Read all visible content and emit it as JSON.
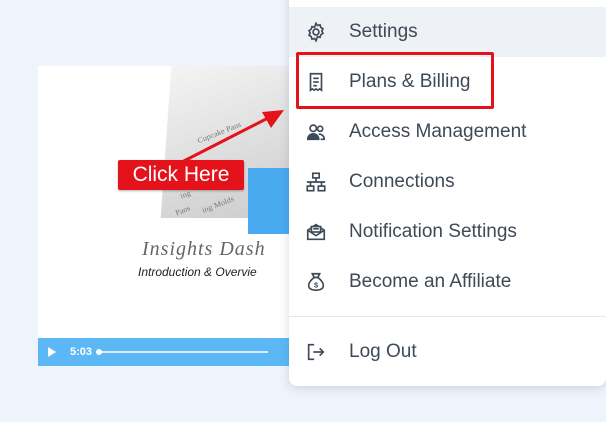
{
  "video": {
    "title": "Insights Dash",
    "subtitle": "Introduction  & Overvie",
    "duration": "5:03",
    "progress": 0.02,
    "thumb_lines": [
      "Cupcake Pans",
      "Pans",
      "ing Molds",
      "ing"
    ]
  },
  "callout": {
    "label": "Click Here",
    "color": "#e4121b"
  },
  "menu": {
    "items": [
      {
        "label": "Settings",
        "icon": "gear-icon"
      },
      {
        "label": "Plans & Billing",
        "icon": "receipt-icon"
      },
      {
        "label": "Access Management",
        "icon": "users-icon"
      },
      {
        "label": "Connections",
        "icon": "network-icon"
      },
      {
        "label": "Notification Settings",
        "icon": "envelope-icon"
      },
      {
        "label": "Become an Affiliate",
        "icon": "money-bag-icon"
      },
      {
        "label": "Log Out",
        "icon": "logout-icon"
      }
    ],
    "highlight_color": "#e4121b"
  }
}
